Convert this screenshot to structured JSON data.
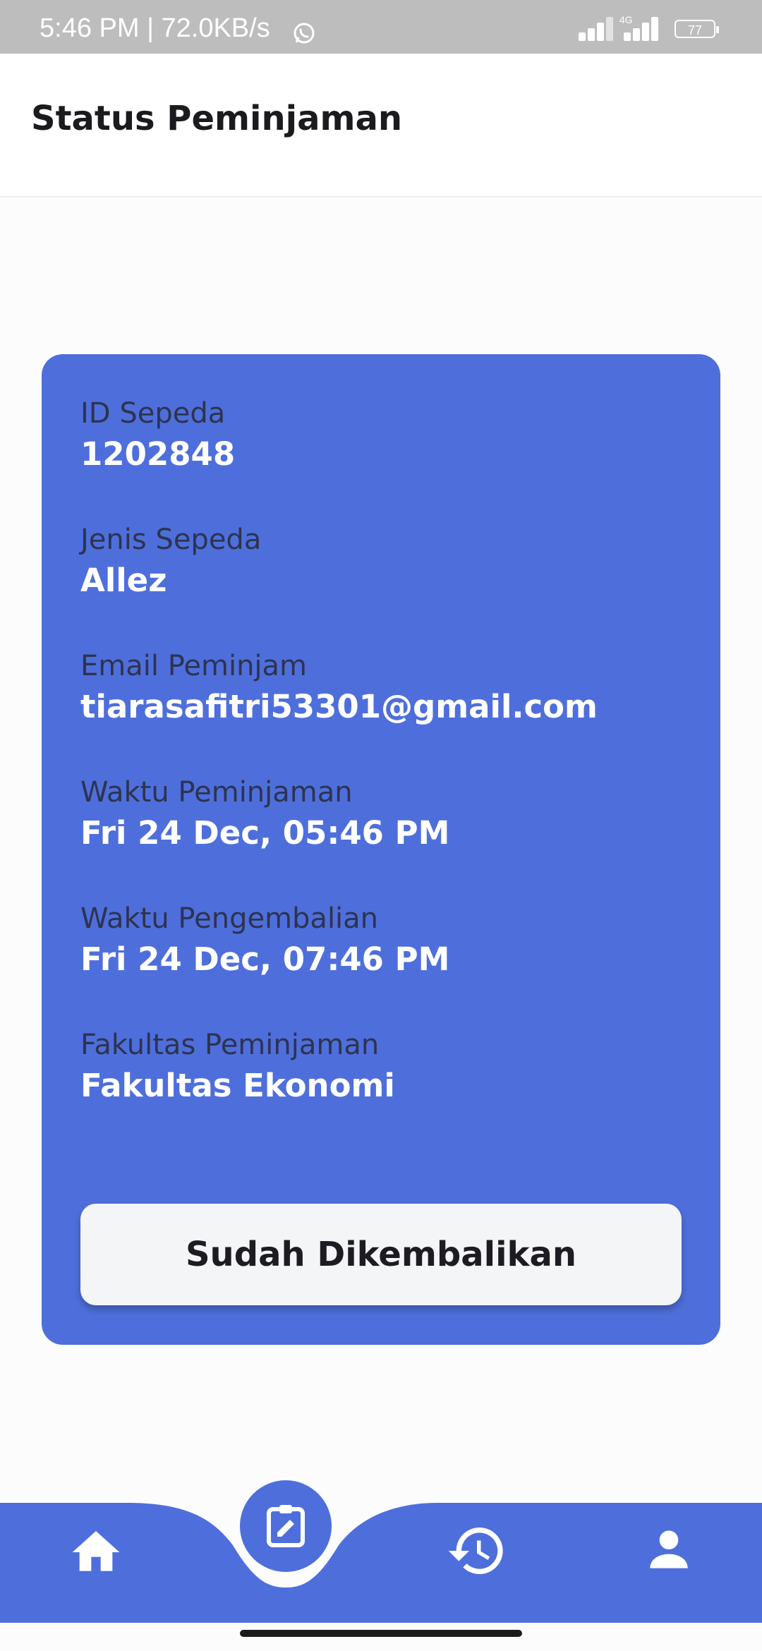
{
  "status_bar": {
    "time_speed": "5:46 PM | 72.0KB/s",
    "network": "4G",
    "battery": "77"
  },
  "header": {
    "title": "Status Peminjaman"
  },
  "card": {
    "fields": [
      {
        "label": "ID Sepeda",
        "value": "1202848"
      },
      {
        "label": "Jenis Sepeda",
        "value": "Allez"
      },
      {
        "label": "Email Peminjam",
        "value": "tiarasafitri53301@gmail.com"
      },
      {
        "label": "Waktu Peminjaman",
        "value": "Fri 24 Dec, 05:46 PM"
      },
      {
        "label": "Waktu Pengembalian",
        "value": "Fri 24 Dec, 07:46 PM"
      },
      {
        "label": "Fakultas Peminjaman",
        "value": "Fakultas Ekonomi"
      }
    ],
    "button_label": "Sudah Dikembalikan"
  },
  "bottom_nav": {
    "items": [
      {
        "icon": "home-icon"
      },
      {
        "icon": "clipboard-edit-icon",
        "active": true
      },
      {
        "icon": "history-icon"
      },
      {
        "icon": "profile-icon"
      }
    ]
  },
  "colors": {
    "accent": "#4e6fdb",
    "label_text": "#2d3350",
    "value_text": "#ffffff",
    "button_bg": "#f4f5f7"
  }
}
